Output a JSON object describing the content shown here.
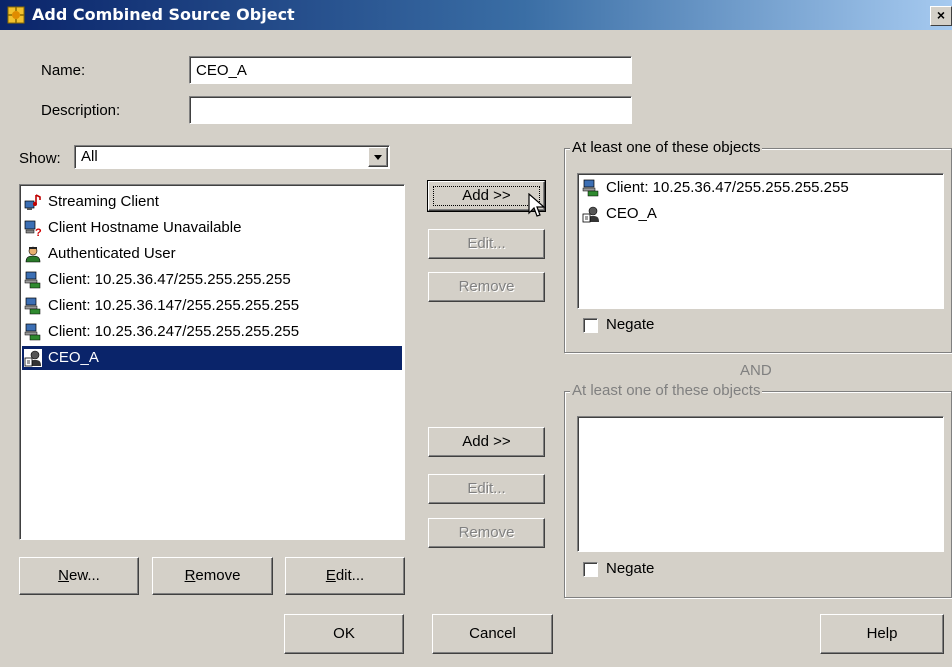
{
  "window": {
    "title": "Add Combined Source Object",
    "icon": "combined-object-icon",
    "close_label": "×"
  },
  "form": {
    "name_label": "Name:",
    "name_value": "CEO_A",
    "description_label": "Description:",
    "description_value": "",
    "show_label": "Show:",
    "show_value": "All"
  },
  "source_list": {
    "items": [
      {
        "label": "Streaming Client",
        "icon": "streaming-client-icon"
      },
      {
        "label": "Client Hostname Unavailable",
        "icon": "client-unavailable-icon"
      },
      {
        "label": "Authenticated User",
        "icon": "authenticated-user-icon"
      },
      {
        "label": "Client: 10.25.36.47/255.255.255.255",
        "icon": "client-ip-icon"
      },
      {
        "label": "Client: 10.25.36.147/255.255.255.255",
        "icon": "client-ip-icon"
      },
      {
        "label": "Client: 10.25.36.247/255.255.255.255",
        "icon": "client-ip-icon"
      },
      {
        "label": "CEO_A",
        "icon": "combined-source-icon",
        "selected": true
      }
    ]
  },
  "list_buttons": {
    "new": "New...",
    "remove": "Remove",
    "edit": "Edit..."
  },
  "group1": {
    "legend": "At least one of these objects",
    "items": [
      {
        "label": "Client: 10.25.36.47/255.255.255.255",
        "icon": "client-ip-icon"
      },
      {
        "label": "CEO_A",
        "icon": "combined-source-icon"
      }
    ],
    "negate_label": "Negate",
    "negate_checked": false,
    "add": "Add >>",
    "edit": "Edit...",
    "remove": "Remove"
  },
  "and_label": "AND",
  "group2": {
    "legend": "At least one of these objects",
    "items": [],
    "negate_label": "Negate",
    "negate_checked": false,
    "add": "Add >>",
    "edit": "Edit...",
    "remove": "Remove"
  },
  "footer": {
    "ok": "OK",
    "cancel": "Cancel",
    "help": "Help"
  },
  "colors": {
    "titlebar": "#0a246a",
    "selection": "#0a246a",
    "dialog_bg": "#d4d0c8"
  }
}
